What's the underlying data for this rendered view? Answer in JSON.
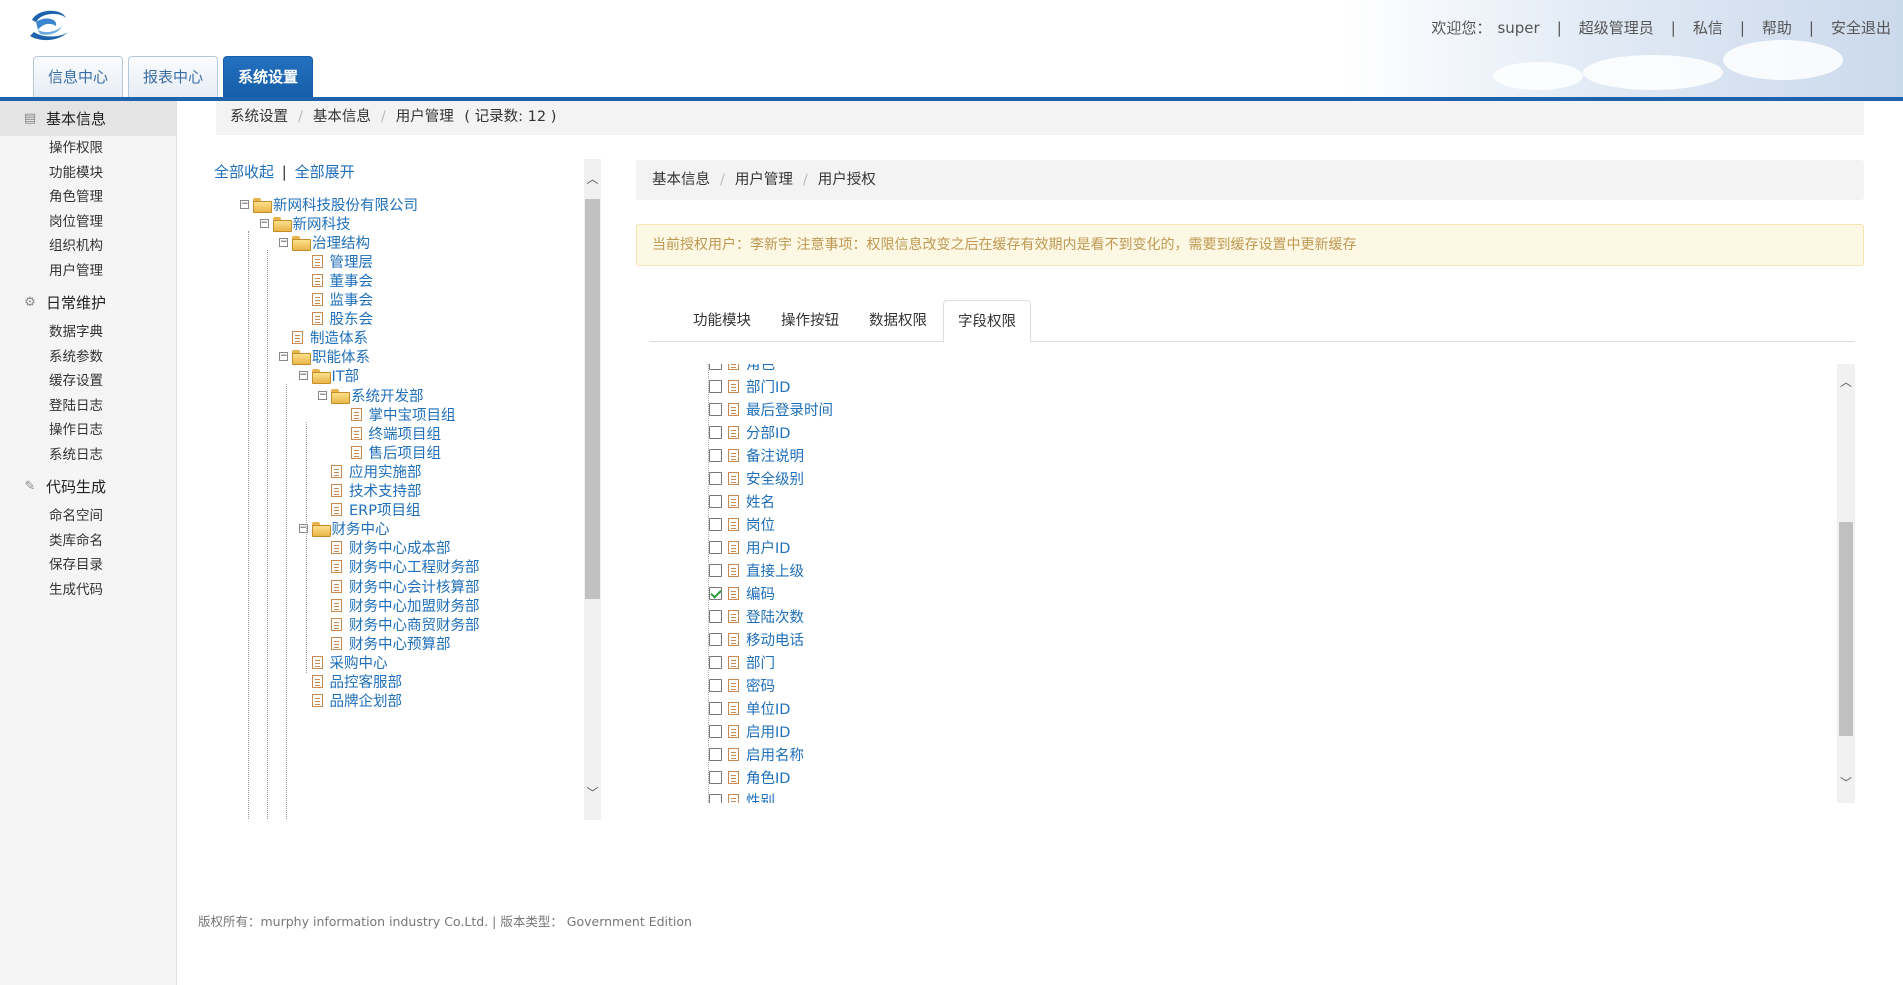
{
  "header": {
    "nav": {
      "welcome": "欢迎您：",
      "user": "super",
      "role": "超级管理员",
      "messages": "私信",
      "help": "帮助",
      "logout": "安全退出"
    },
    "tabs": [
      {
        "label": "信息中心"
      },
      {
        "label": "报表中心"
      },
      {
        "label": "系统设置"
      }
    ]
  },
  "sidebar": {
    "groups": [
      {
        "title": "基本信息",
        "items": [
          "操作权限",
          "功能模块",
          "角色管理",
          "岗位管理",
          "组织机构",
          "用户管理"
        ]
      },
      {
        "title": "日常维护",
        "items": [
          "数据字典",
          "系统参数",
          "缓存设置",
          "登陆日志",
          "操作日志",
          "系统日志"
        ]
      },
      {
        "title": "代码生成",
        "items": [
          "命名空间",
          "类库命名",
          "保存目录",
          "生成代码"
        ]
      }
    ]
  },
  "breadcrumb": {
    "items": [
      "系统设置",
      "基本信息",
      "用户管理"
    ],
    "count": "( 记录数: 12 )"
  },
  "tree": {
    "collapse_all": "全部收起",
    "divider": "|",
    "expand_all": "全部展开",
    "nodes": [
      {
        "label": "新网科技股份有限公司",
        "type": "folder"
      },
      {
        "label": "新网科技",
        "type": "folder"
      },
      {
        "label": "治理结构",
        "type": "folder"
      },
      {
        "label": "管理层",
        "type": "page"
      },
      {
        "label": "董事会",
        "type": "page"
      },
      {
        "label": "监事会",
        "type": "page"
      },
      {
        "label": "股东会",
        "type": "page"
      },
      {
        "label": "制造体系",
        "type": "page"
      },
      {
        "label": "职能体系",
        "type": "folder"
      },
      {
        "label": "IT部",
        "type": "folder"
      },
      {
        "label": "系统开发部",
        "type": "folder"
      },
      {
        "label": "掌中宝项目组",
        "type": "page"
      },
      {
        "label": "终端项目组",
        "type": "page"
      },
      {
        "label": "售后项目组",
        "type": "page"
      },
      {
        "label": "应用实施部",
        "type": "page"
      },
      {
        "label": "技术支持部",
        "type": "page"
      },
      {
        "label": "ERP项目组",
        "type": "page"
      },
      {
        "label": "财务中心",
        "type": "folder"
      },
      {
        "label": "财务中心成本部",
        "type": "page"
      },
      {
        "label": "财务中心工程财务部",
        "type": "page"
      },
      {
        "label": "财务中心会计核算部",
        "type": "page"
      },
      {
        "label": "财务中心加盟财务部",
        "type": "page"
      },
      {
        "label": "财务中心商贸财务部",
        "type": "page"
      },
      {
        "label": "财务中心预算部",
        "type": "page"
      },
      {
        "label": "采购中心",
        "type": "page"
      },
      {
        "label": "品控客服部",
        "type": "page"
      },
      {
        "label": "品牌企划部",
        "type": "page"
      }
    ]
  },
  "right_panel": {
    "breadcrumb": [
      "基本信息",
      "用户管理",
      "用户授权"
    ],
    "notice": "当前授权用户：李新宇 注意事项：权限信息改变之后在缓存有效期内是看不到变化的，需要到缓存设置中更新缓存",
    "tabs": [
      {
        "label": "功能模块"
      },
      {
        "label": "操作按钮"
      },
      {
        "label": "数据权限"
      },
      {
        "label": "字段权限"
      }
    ],
    "active_tab": "字段权限",
    "fields": [
      {
        "label": "角色",
        "checked": false
      },
      {
        "label": "部门ID",
        "checked": false
      },
      {
        "label": "最后登录时间",
        "checked": false
      },
      {
        "label": "分部ID",
        "checked": false
      },
      {
        "label": "备注说明",
        "checked": false
      },
      {
        "label": "安全级别",
        "checked": false
      },
      {
        "label": "姓名",
        "checked": false
      },
      {
        "label": "岗位",
        "checked": false
      },
      {
        "label": "用户ID",
        "checked": false
      },
      {
        "label": "直接上级",
        "checked": false
      },
      {
        "label": "编码",
        "checked": true
      },
      {
        "label": "登陆次数",
        "checked": false
      },
      {
        "label": "移动电话",
        "checked": false
      },
      {
        "label": "部门",
        "checked": false
      },
      {
        "label": "密码",
        "checked": false
      },
      {
        "label": "单位ID",
        "checked": false
      },
      {
        "label": "启用ID",
        "checked": false
      },
      {
        "label": "启用名称",
        "checked": false
      },
      {
        "label": "角色ID",
        "checked": false
      },
      {
        "label": "性别",
        "checked": false
      }
    ]
  },
  "footer": {
    "text": "版权所有：murphy information industry Co.Ltd. | 版本类型： Government Edition"
  },
  "colors": {
    "brand_blue": "#1d62ab",
    "link_blue": "#1f6fba",
    "notice_text": "#c09853",
    "notice_bg": "#fcf8e3"
  }
}
